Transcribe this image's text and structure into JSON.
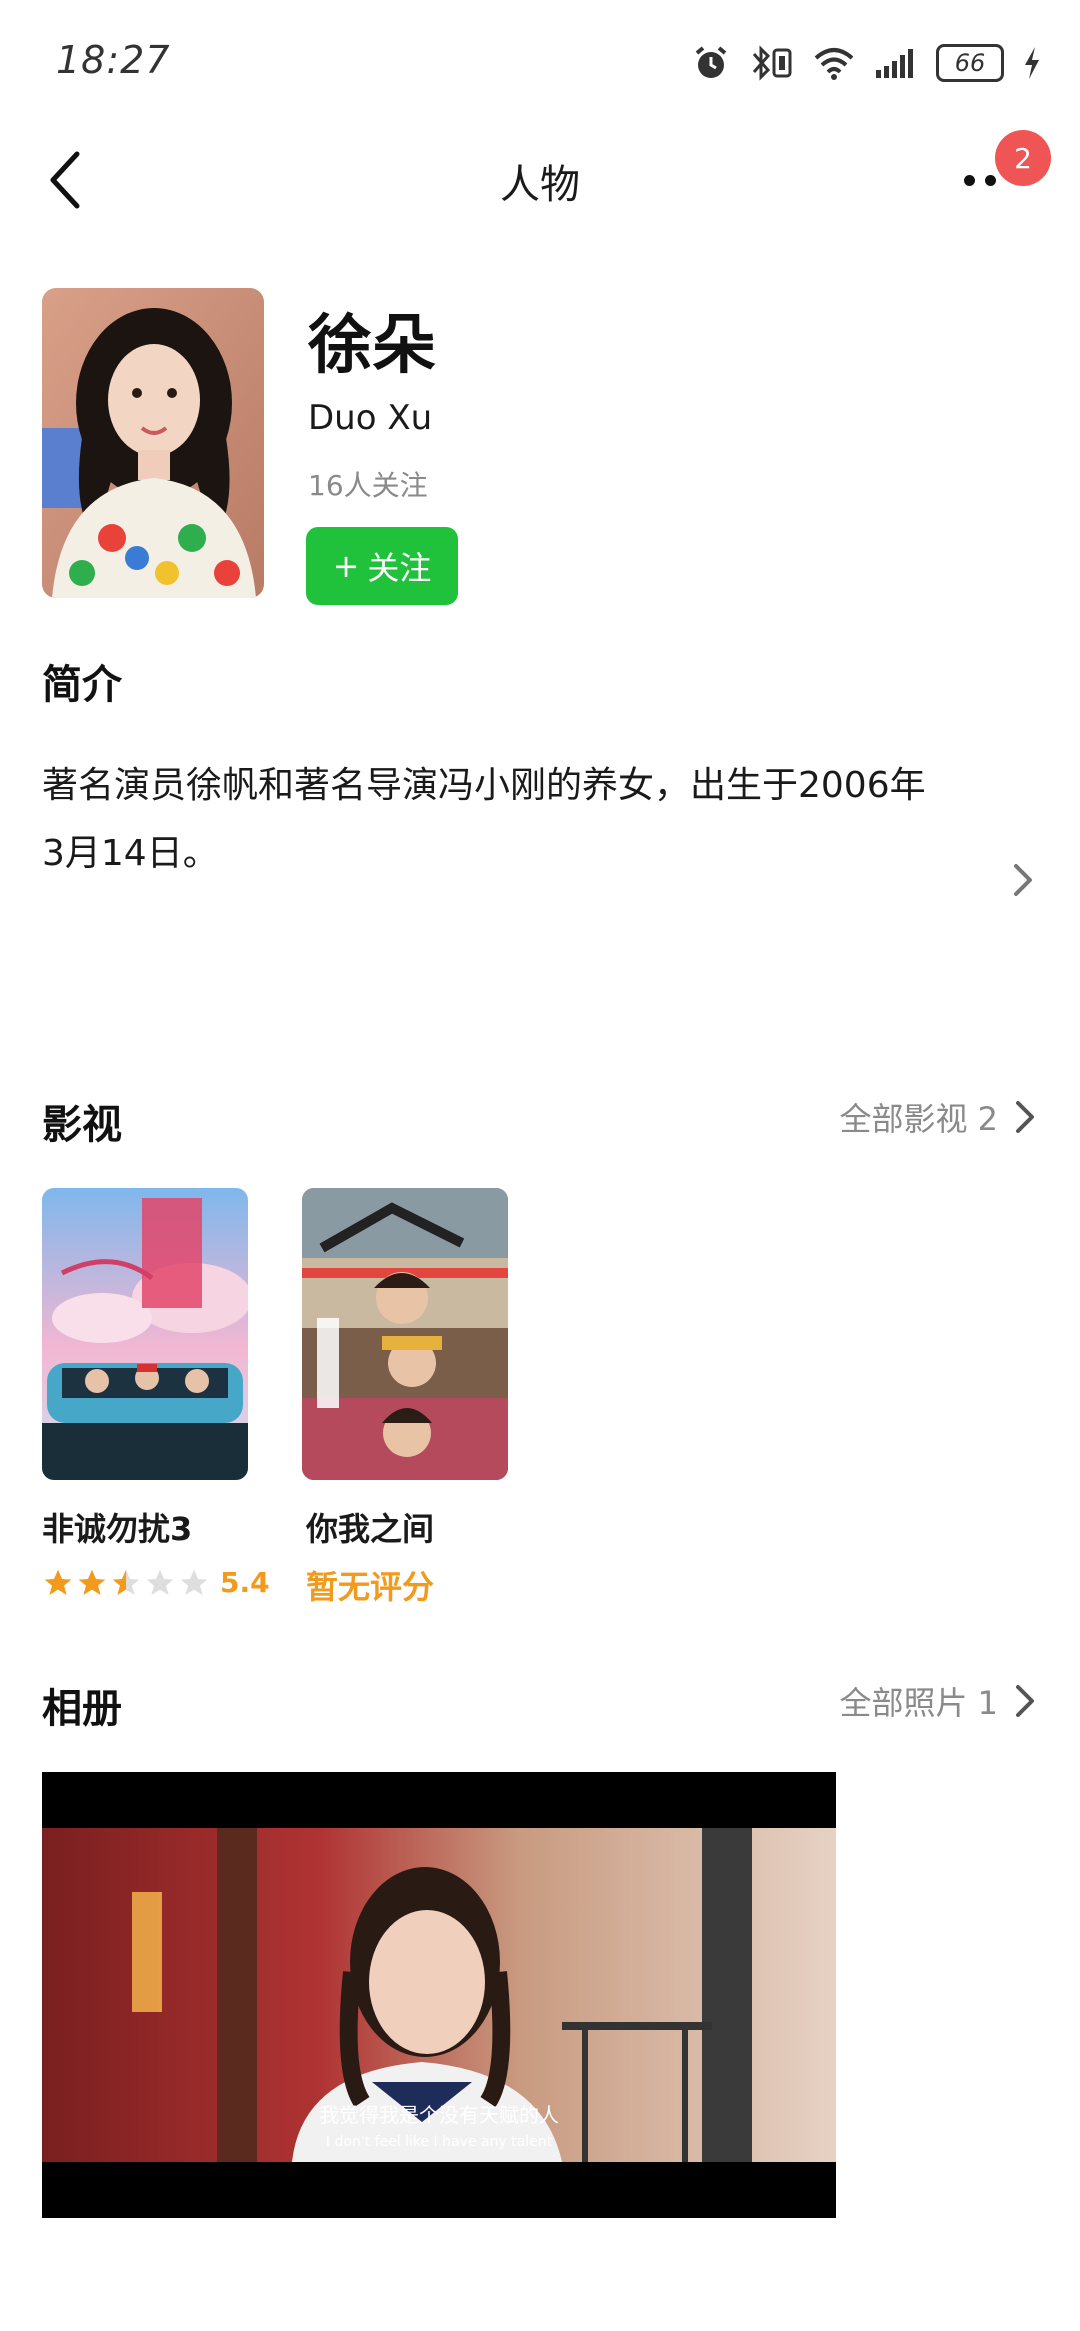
{
  "status_bar": {
    "time": "18:27",
    "battery": "66",
    "icons": [
      "alarm-icon",
      "bluetooth-icon",
      "wifi-icon",
      "signal-icon",
      "battery-icon",
      "charging-icon"
    ]
  },
  "header": {
    "title": "人物",
    "notification_count": "2"
  },
  "profile": {
    "name": "徐朵",
    "name_en": "Duo Xu",
    "followers": "16人关注",
    "follow_button": "关注",
    "follow_plus": "+"
  },
  "intro": {
    "title": "简介",
    "text": "著名演员徐帆和著名导演冯小刚的养女，出生于2006年3月14日。"
  },
  "works": {
    "title": "影视",
    "more": "全部影视 2",
    "items": [
      {
        "title": "非诚勿扰3",
        "rating": "5.4",
        "stars": 2.5
      },
      {
        "title": "你我之间",
        "rating_text": "暂无评分"
      }
    ]
  },
  "album": {
    "title": "相册",
    "more": "全部照片 1",
    "photo_caption_cn": "我觉得我是个没有天赋的人",
    "photo_caption_en": "I don't feel like I have any talent"
  },
  "colors": {
    "follow_green": "#20c13b",
    "badge_red": "#f05555",
    "rating_orange": "#f29a1c"
  }
}
